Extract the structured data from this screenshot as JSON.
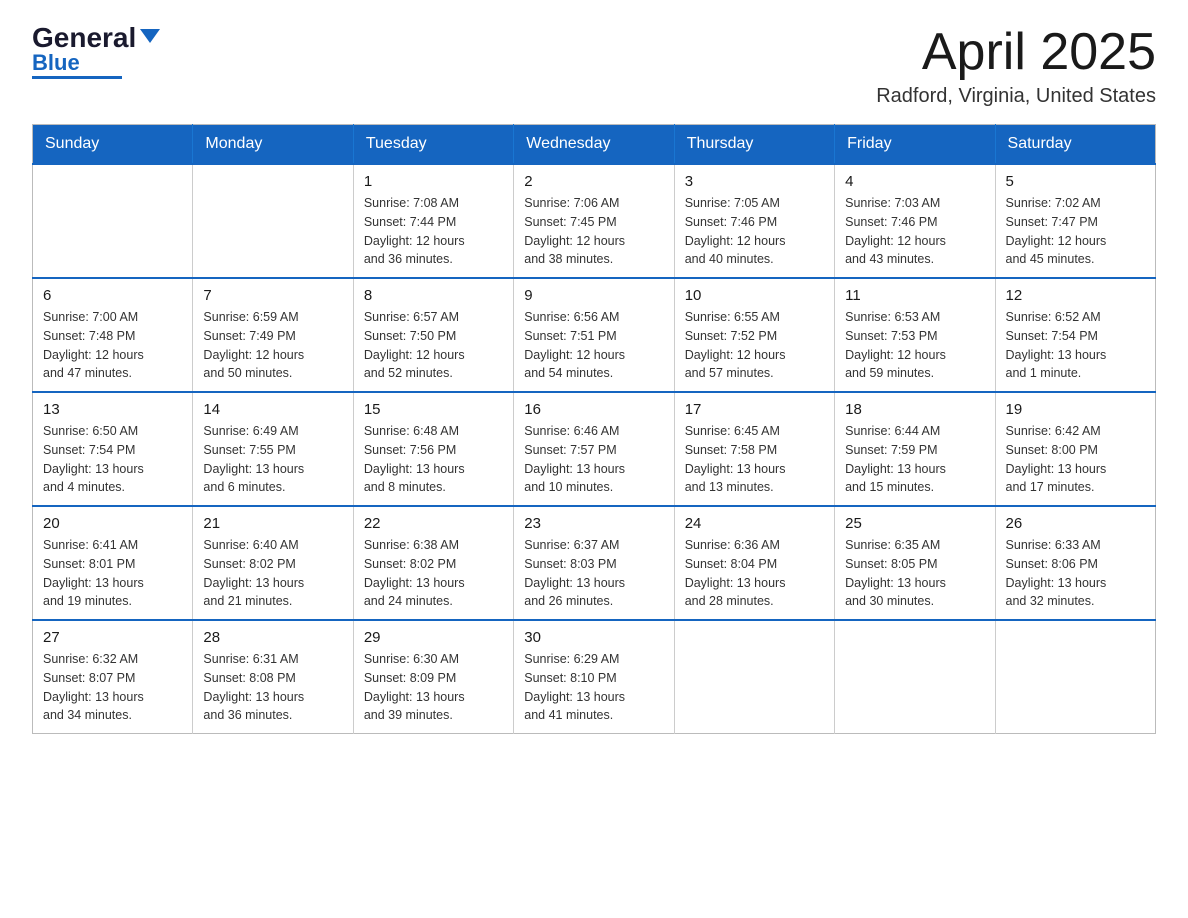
{
  "header": {
    "logo": {
      "general": "General",
      "blue": "Blue",
      "underline_color": "#1565c0"
    },
    "title": "April 2025",
    "location": "Radford, Virginia, United States"
  },
  "calendar": {
    "days_of_week": [
      "Sunday",
      "Monday",
      "Tuesday",
      "Wednesday",
      "Thursday",
      "Friday",
      "Saturday"
    ],
    "weeks": [
      [
        {
          "day": "",
          "info": ""
        },
        {
          "day": "",
          "info": ""
        },
        {
          "day": "1",
          "info": "Sunrise: 7:08 AM\nSunset: 7:44 PM\nDaylight: 12 hours\nand 36 minutes."
        },
        {
          "day": "2",
          "info": "Sunrise: 7:06 AM\nSunset: 7:45 PM\nDaylight: 12 hours\nand 38 minutes."
        },
        {
          "day": "3",
          "info": "Sunrise: 7:05 AM\nSunset: 7:46 PM\nDaylight: 12 hours\nand 40 minutes."
        },
        {
          "day": "4",
          "info": "Sunrise: 7:03 AM\nSunset: 7:46 PM\nDaylight: 12 hours\nand 43 minutes."
        },
        {
          "day": "5",
          "info": "Sunrise: 7:02 AM\nSunset: 7:47 PM\nDaylight: 12 hours\nand 45 minutes."
        }
      ],
      [
        {
          "day": "6",
          "info": "Sunrise: 7:00 AM\nSunset: 7:48 PM\nDaylight: 12 hours\nand 47 minutes."
        },
        {
          "day": "7",
          "info": "Sunrise: 6:59 AM\nSunset: 7:49 PM\nDaylight: 12 hours\nand 50 minutes."
        },
        {
          "day": "8",
          "info": "Sunrise: 6:57 AM\nSunset: 7:50 PM\nDaylight: 12 hours\nand 52 minutes."
        },
        {
          "day": "9",
          "info": "Sunrise: 6:56 AM\nSunset: 7:51 PM\nDaylight: 12 hours\nand 54 minutes."
        },
        {
          "day": "10",
          "info": "Sunrise: 6:55 AM\nSunset: 7:52 PM\nDaylight: 12 hours\nand 57 minutes."
        },
        {
          "day": "11",
          "info": "Sunrise: 6:53 AM\nSunset: 7:53 PM\nDaylight: 12 hours\nand 59 minutes."
        },
        {
          "day": "12",
          "info": "Sunrise: 6:52 AM\nSunset: 7:54 PM\nDaylight: 13 hours\nand 1 minute."
        }
      ],
      [
        {
          "day": "13",
          "info": "Sunrise: 6:50 AM\nSunset: 7:54 PM\nDaylight: 13 hours\nand 4 minutes."
        },
        {
          "day": "14",
          "info": "Sunrise: 6:49 AM\nSunset: 7:55 PM\nDaylight: 13 hours\nand 6 minutes."
        },
        {
          "day": "15",
          "info": "Sunrise: 6:48 AM\nSunset: 7:56 PM\nDaylight: 13 hours\nand 8 minutes."
        },
        {
          "day": "16",
          "info": "Sunrise: 6:46 AM\nSunset: 7:57 PM\nDaylight: 13 hours\nand 10 minutes."
        },
        {
          "day": "17",
          "info": "Sunrise: 6:45 AM\nSunset: 7:58 PM\nDaylight: 13 hours\nand 13 minutes."
        },
        {
          "day": "18",
          "info": "Sunrise: 6:44 AM\nSunset: 7:59 PM\nDaylight: 13 hours\nand 15 minutes."
        },
        {
          "day": "19",
          "info": "Sunrise: 6:42 AM\nSunset: 8:00 PM\nDaylight: 13 hours\nand 17 minutes."
        }
      ],
      [
        {
          "day": "20",
          "info": "Sunrise: 6:41 AM\nSunset: 8:01 PM\nDaylight: 13 hours\nand 19 minutes."
        },
        {
          "day": "21",
          "info": "Sunrise: 6:40 AM\nSunset: 8:02 PM\nDaylight: 13 hours\nand 21 minutes."
        },
        {
          "day": "22",
          "info": "Sunrise: 6:38 AM\nSunset: 8:02 PM\nDaylight: 13 hours\nand 24 minutes."
        },
        {
          "day": "23",
          "info": "Sunrise: 6:37 AM\nSunset: 8:03 PM\nDaylight: 13 hours\nand 26 minutes."
        },
        {
          "day": "24",
          "info": "Sunrise: 6:36 AM\nSunset: 8:04 PM\nDaylight: 13 hours\nand 28 minutes."
        },
        {
          "day": "25",
          "info": "Sunrise: 6:35 AM\nSunset: 8:05 PM\nDaylight: 13 hours\nand 30 minutes."
        },
        {
          "day": "26",
          "info": "Sunrise: 6:33 AM\nSunset: 8:06 PM\nDaylight: 13 hours\nand 32 minutes."
        }
      ],
      [
        {
          "day": "27",
          "info": "Sunrise: 6:32 AM\nSunset: 8:07 PM\nDaylight: 13 hours\nand 34 minutes."
        },
        {
          "day": "28",
          "info": "Sunrise: 6:31 AM\nSunset: 8:08 PM\nDaylight: 13 hours\nand 36 minutes."
        },
        {
          "day": "29",
          "info": "Sunrise: 6:30 AM\nSunset: 8:09 PM\nDaylight: 13 hours\nand 39 minutes."
        },
        {
          "day": "30",
          "info": "Sunrise: 6:29 AM\nSunset: 8:10 PM\nDaylight: 13 hours\nand 41 minutes."
        },
        {
          "day": "",
          "info": ""
        },
        {
          "day": "",
          "info": ""
        },
        {
          "day": "",
          "info": ""
        }
      ]
    ]
  }
}
